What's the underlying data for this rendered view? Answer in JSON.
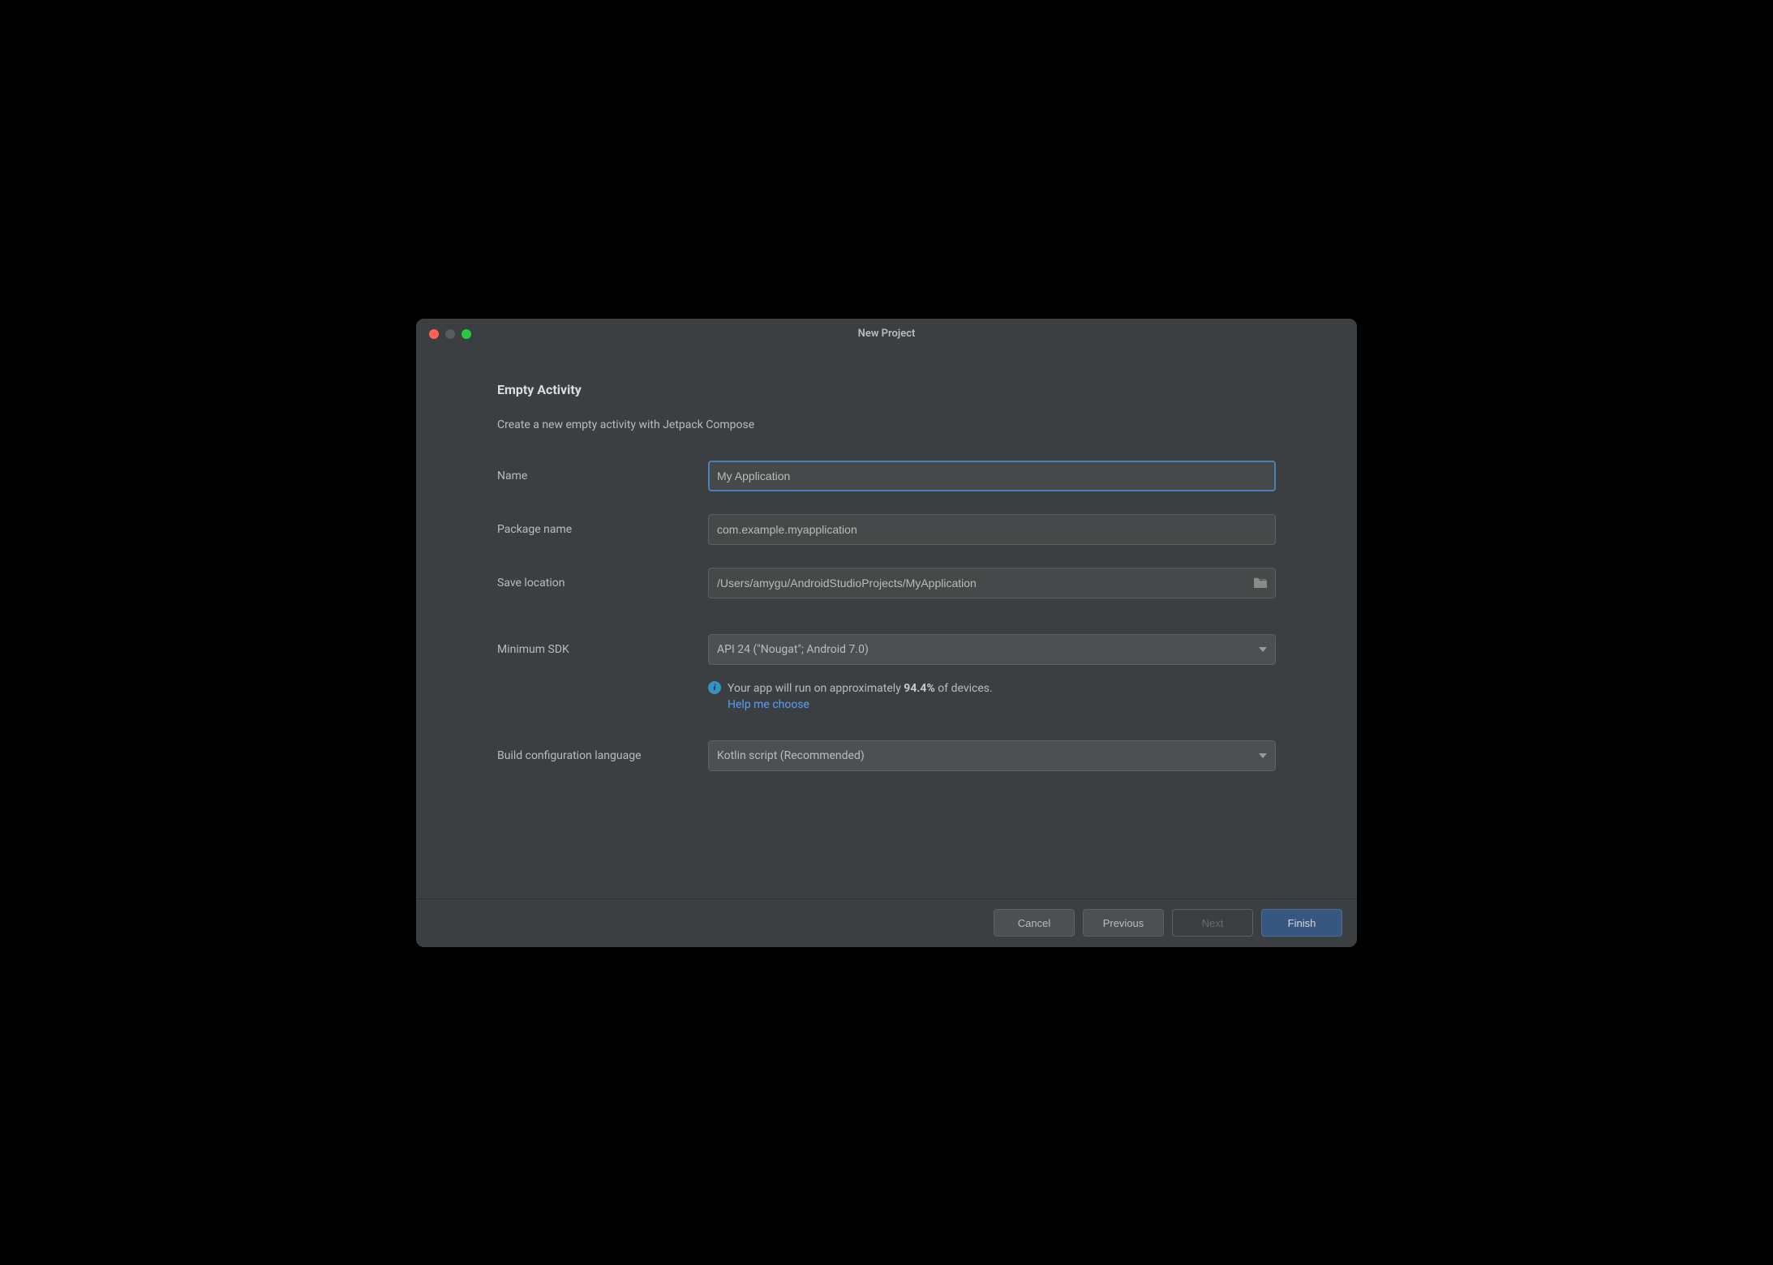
{
  "window": {
    "title": "New Project"
  },
  "heading": "Empty Activity",
  "subheading": "Create a new empty activity with Jetpack Compose",
  "form": {
    "name_label": "Name",
    "name_value": "My Application",
    "package_label": "Package name",
    "package_value": "com.example.myapplication",
    "location_label": "Save location",
    "location_value": "/Users/amygu/AndroidStudioProjects/MyApplication",
    "sdk_label": "Minimum SDK",
    "sdk_value": "API 24 (\"Nougat\"; Android 7.0)",
    "buildlang_label": "Build configuration language",
    "buildlang_value": "Kotlin script (Recommended)"
  },
  "info": {
    "text_prefix": "Your app will run on approximately ",
    "percent": "94.4%",
    "text_suffix": " of devices.",
    "link": "Help me choose"
  },
  "footer": {
    "cancel": "Cancel",
    "previous": "Previous",
    "next": "Next",
    "finish": "Finish"
  }
}
